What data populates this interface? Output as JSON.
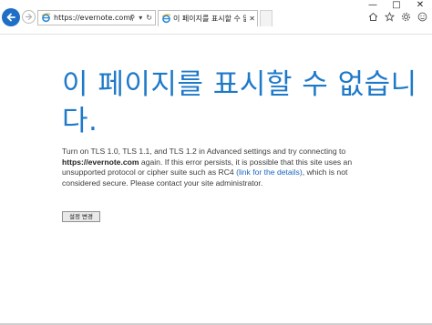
{
  "window": {
    "minimize_glyph": "—",
    "maximize_glyph": "□",
    "close_glyph": "✕"
  },
  "addressbar": {
    "url": "https://evernote.com/",
    "search_glyph": "⚲",
    "dropdown_glyph": "▾",
    "refresh_glyph": "↻"
  },
  "tab": {
    "title": "이 페이지를 표시할 수 없...",
    "close_glyph": "✕"
  },
  "toolbar": {
    "icons": [
      "home-icon",
      "favorites-star-icon",
      "settings-gear-icon",
      "smiley-feedback-icon"
    ]
  },
  "page": {
    "heading": "이 페이지를 표시할 수 없습니다.",
    "para_pre": "Turn on TLS 1.0, TLS 1.1, and TLS 1.2 in Advanced settings and try connecting to ",
    "para_url": "https://evernote.com",
    "para_mid": " again. If this error persists, it is possible that this site uses an unsupported protocol or cipher suite such as RC4 ",
    "para_link": "(link for the details)",
    "para_post": ", which is not considered secure. Please contact your site administrator.",
    "button_label": "설정 변경"
  },
  "colors": {
    "accent": "#1e79c9",
    "link": "#1a66c2",
    "back_button": "#1e6fc5"
  }
}
